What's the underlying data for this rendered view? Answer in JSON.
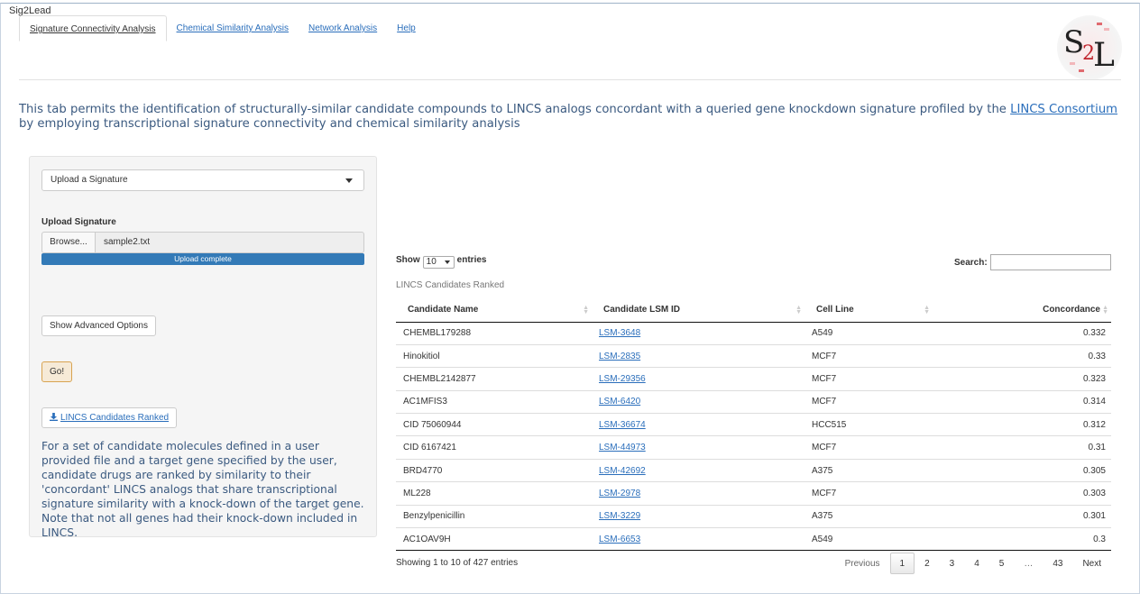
{
  "app": {
    "title": "Sig2Lead"
  },
  "tabs": [
    {
      "label": "Signature Connectivity Analysis",
      "active": true
    },
    {
      "label": "Chemical Similarity Analysis"
    },
    {
      "label": "Network Analysis"
    },
    {
      "label": "Help"
    }
  ],
  "logo": {
    "text_s": "S",
    "text_2": "2",
    "text_l": "L"
  },
  "intro": {
    "text_before": "This tab permits the identification of structurally-similar candidate compounds to LINCS analogs concordant with a queried gene knockdown signature profiled by the ",
    "link": "LINCS Consortium",
    "text_after": " by employing transcriptional signature connectivity and chemical similarity analysis"
  },
  "sidebar": {
    "mode_select": "Upload a Signature",
    "upload_label": "Upload Signature",
    "browse_label": "Browse...",
    "file_name": "sample2.txt",
    "progress_text": "Upload complete",
    "advanced_button": "Show Advanced Options",
    "go_button": "Go!",
    "download_button": "LINCS Candidates Ranked",
    "description": "For a set of candidate molecules defined in a user provided file and a target gene specified by the user, candidate drugs are ranked by similarity to their 'concordant' LINCS analogs that share transcriptional signature similarity with a knock-down of the target gene. Note that not all genes had their knock-down included in LINCS."
  },
  "table": {
    "show_label": "Show",
    "page_length": "10",
    "entries_label": "entries",
    "search_label": "Search:",
    "caption": "LINCS Candidates Ranked",
    "columns": [
      "Candidate Name",
      "Candidate LSM ID",
      "Cell Line",
      "Concordance"
    ],
    "rows": [
      [
        "CHEMBL179288",
        "LSM-3648",
        "A549",
        "0.332"
      ],
      [
        "Hinokitiol",
        "LSM-2835",
        "MCF7",
        "0.33"
      ],
      [
        "CHEMBL2142877",
        "LSM-29356",
        "MCF7",
        "0.323"
      ],
      [
        "AC1MFIS3",
        "LSM-6420",
        "MCF7",
        "0.314"
      ],
      [
        "CID 75060944",
        "LSM-36674",
        "HCC515",
        "0.312"
      ],
      [
        "CID 6167421",
        "LSM-44973",
        "MCF7",
        "0.31"
      ],
      [
        "BRD4770",
        "LSM-42692",
        "A375",
        "0.305"
      ],
      [
        "ML228",
        "LSM-2978",
        "MCF7",
        "0.303"
      ],
      [
        "Benzylpenicillin",
        "LSM-3229",
        "A375",
        "0.301"
      ],
      [
        "AC1OAV9H",
        "LSM-6653",
        "A549",
        "0.3"
      ]
    ],
    "info": "Showing 1 to 10 of 427 entries",
    "pagination": {
      "previous": "Previous",
      "pages": [
        "1",
        "2",
        "3",
        "4",
        "5",
        "…",
        "43"
      ],
      "current": "1",
      "next": "Next"
    }
  },
  "colors": {
    "accent": "#337ab7",
    "link": "#2a6ebb",
    "text_blue": "#3b5a80"
  }
}
